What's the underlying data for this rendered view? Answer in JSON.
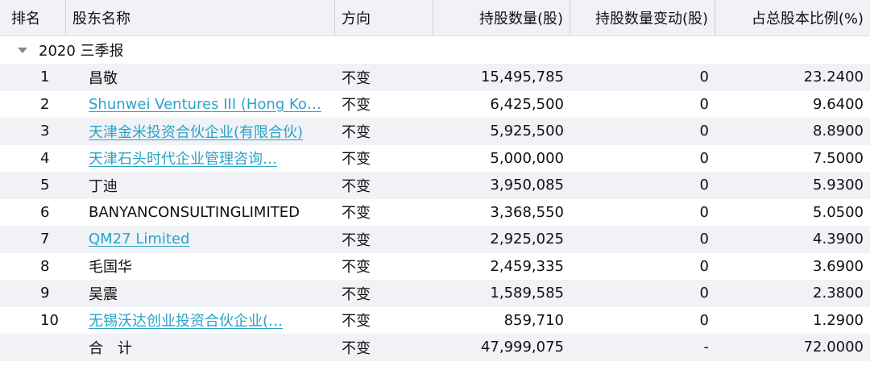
{
  "columns": [
    "排名",
    "股东名称",
    "方向",
    "持股数量(股)",
    "持股数量变动(股)",
    "占总股本比例(%)"
  ],
  "group_label": "2020 三季报",
  "rows": [
    {
      "rank": "1",
      "name": "昌敬",
      "link": false,
      "direction": "不变",
      "shares": "15,495,785",
      "change": "0",
      "ratio": "23.2400"
    },
    {
      "rank": "2",
      "name": "Shunwei Ventures III (Hong Ko…",
      "link": true,
      "direction": "不变",
      "shares": "6,425,500",
      "change": "0",
      "ratio": "9.6400"
    },
    {
      "rank": "3",
      "name": "天津金米投资合伙企业(有限合伙)",
      "link": true,
      "direction": "不变",
      "shares": "5,925,500",
      "change": "0",
      "ratio": "8.8900"
    },
    {
      "rank": "4",
      "name": "天津石头时代企业管理咨询…",
      "link": true,
      "direction": "不变",
      "shares": "5,000,000",
      "change": "0",
      "ratio": "7.5000"
    },
    {
      "rank": "5",
      "name": "丁迪",
      "link": false,
      "direction": "不变",
      "shares": "3,950,085",
      "change": "0",
      "ratio": "5.9300"
    },
    {
      "rank": "6",
      "name": "BANYANCONSULTINGLIMITED",
      "link": false,
      "direction": "不变",
      "shares": "3,368,550",
      "change": "0",
      "ratio": "5.0500"
    },
    {
      "rank": "7",
      "name": "QM27 Limited",
      "link": true,
      "direction": "不变",
      "shares": "2,925,025",
      "change": "0",
      "ratio": "4.3900"
    },
    {
      "rank": "8",
      "name": "毛国华",
      "link": false,
      "direction": "不变",
      "shares": "2,459,335",
      "change": "0",
      "ratio": "3.6900"
    },
    {
      "rank": "9",
      "name": "吴震",
      "link": false,
      "direction": "不变",
      "shares": "1,589,585",
      "change": "0",
      "ratio": "2.3800"
    },
    {
      "rank": "10",
      "name": "无锡沃达创业投资合伙企业(…",
      "link": true,
      "direction": "不变",
      "shares": "859,710",
      "change": "0",
      "ratio": "1.2900"
    }
  ],
  "total": {
    "label": "合　计",
    "direction": "不变",
    "shares": "47,999,075",
    "change": "-",
    "ratio": "72.0000"
  }
}
